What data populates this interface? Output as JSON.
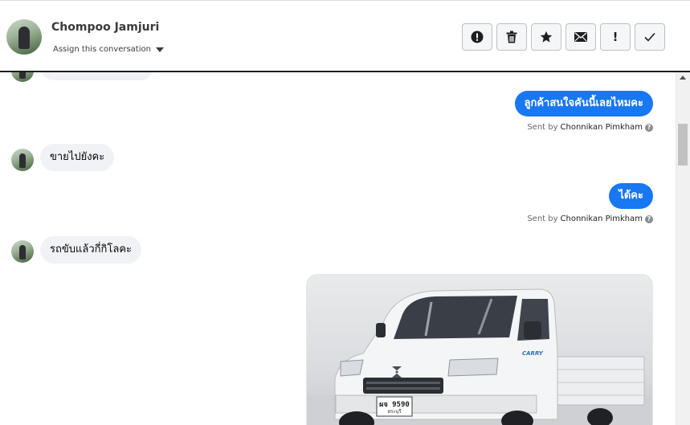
{
  "header": {
    "contact_name": "Chompoo Jamjuri",
    "assign_label": "Assign this conversation",
    "actions": [
      {
        "name": "report-button",
        "icon": "exclamation-circle-icon"
      },
      {
        "name": "delete-button",
        "icon": "trash-icon"
      },
      {
        "name": "star-button",
        "icon": "star-icon"
      },
      {
        "name": "mark-unread-button",
        "icon": "envelope-icon"
      },
      {
        "name": "mark-important-button",
        "label": "!"
      },
      {
        "name": "mark-done-button",
        "icon": "checkmark-icon"
      }
    ]
  },
  "messages": [
    {
      "direction": "out",
      "text": "ลูกค้าสนใจคันนี้เลยไหมคะ",
      "sent_by_prefix": "Sent by",
      "sent_by_name": "Chonnikan Pimkham"
    },
    {
      "direction": "in",
      "text": "ขายไปยังคะ"
    },
    {
      "direction": "out",
      "text": "ได้คะ",
      "sent_by_prefix": "Sent by",
      "sent_by_name": "Chonnikan Pimkham"
    },
    {
      "direction": "in",
      "text": "รถขับแล้วกี่กิโลคะ"
    },
    {
      "direction": "out",
      "type": "image",
      "image_subject": "white Suzuki Carry pickup truck",
      "plate_text": "ผจ 9590",
      "plate_province": "สระบุรี",
      "badge_text": "CARRY"
    }
  ],
  "colors": {
    "accent": "#1877f2",
    "incoming_bubble": "#f0f2f5",
    "header_border": "#1c1e21"
  }
}
